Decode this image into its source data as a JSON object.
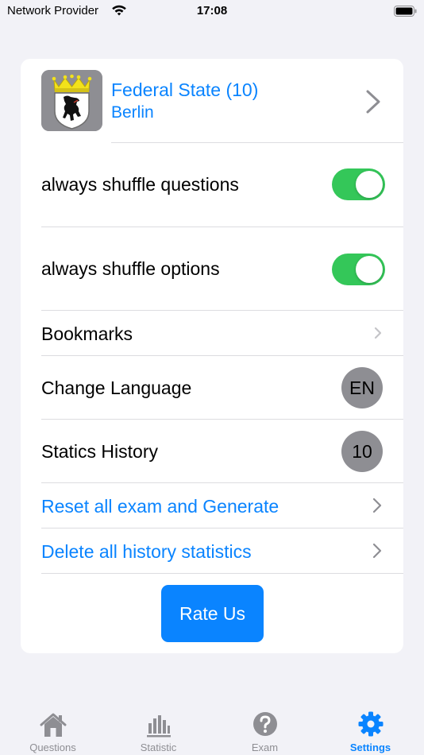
{
  "status_bar": {
    "carrier": "Network Provider",
    "time": "17:08",
    "icons": [
      "wifi-icon",
      "battery-icon"
    ]
  },
  "settings": {
    "federal_state": {
      "title": "Federal State (10)",
      "subtitle": "Berlin",
      "icon": "berlin-coat-of-arms-icon"
    },
    "shuffle_questions": {
      "label": "always shuffle questions",
      "on": true
    },
    "shuffle_options": {
      "label": "always shuffle options",
      "on": true
    },
    "bookmarks": {
      "label": "Bookmarks"
    },
    "change_language": {
      "label": "Change Language",
      "value": "EN"
    },
    "statics_history": {
      "label": "Statics History",
      "value": "10"
    },
    "reset_exam": {
      "label": "Reset all exam and Generate"
    },
    "delete_history": {
      "label": "Delete all history statistics"
    },
    "rate_us": {
      "label": "Rate Us"
    }
  },
  "tab_bar": {
    "tabs": [
      {
        "label": "Questions",
        "icon": "house-icon",
        "active": false
      },
      {
        "label": "Statistic",
        "icon": "bar-chart-icon",
        "active": false
      },
      {
        "label": "Exam",
        "icon": "question-circle-icon",
        "active": false
      },
      {
        "label": "Settings",
        "icon": "gear-icon",
        "active": true
      }
    ]
  },
  "colors": {
    "accent": "#0a84ff",
    "toggle_on": "#34c759",
    "inactive": "#8e8e93",
    "background": "#f2f2f7"
  }
}
